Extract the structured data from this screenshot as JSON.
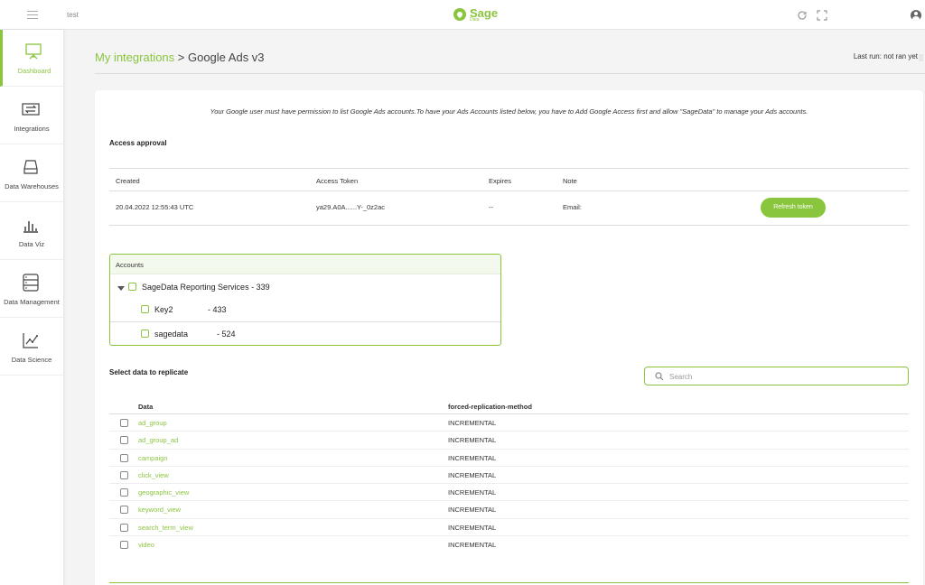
{
  "topbar": {
    "title": "test",
    "logo_big": "Sage",
    "logo_small": "Data"
  },
  "sidebar": {
    "items": [
      {
        "label": "Dashboard",
        "icon": "presentation-board-icon",
        "active": true
      },
      {
        "label": "Integrations",
        "icon": "arrows-exchange-icon",
        "active": false
      },
      {
        "label": "Data Warehouses",
        "icon": "hard-drive-icon",
        "active": false
      },
      {
        "label": "Data Viz",
        "icon": "bar-chart-icon",
        "active": false
      },
      {
        "label": "Data Management",
        "icon": "server-rack-icon",
        "active": false
      },
      {
        "label": "Data Science",
        "icon": "line-graph-icon",
        "active": false
      }
    ]
  },
  "header": {
    "breadcrumb_link": "My integrations",
    "breadcrumb_sep": " > ",
    "breadcrumb_current": "Google Ads v3",
    "last_run": "Last run: not ran yet"
  },
  "notice": "Your Google user must have permission to list Google Ads accounts.To have your Ads Accounts listed below, you have to Add Google Access first and allow \"SageData\" to manage your Ads accounts.",
  "access": {
    "title": "Access approval",
    "columns": [
      "Created",
      "Access Token",
      "Expires",
      "Note"
    ],
    "row": {
      "created": "20.04.2022 12:55:43 UTC",
      "token": "ya29.A0A......Y-_0z2ac",
      "expires": "--",
      "note": "Email:",
      "button": "Refresh token"
    }
  },
  "accounts": {
    "title": "Accounts",
    "parent": "SageData Reporting Services - 339",
    "children": [
      {
        "name": "Key2",
        "id": "- 433"
      },
      {
        "name": "sagedata",
        "id": "- 524"
      }
    ]
  },
  "replicate": {
    "title": "Select data to replicate",
    "search_placeholder": "Search",
    "columns": [
      "Data",
      "forced-replication-method"
    ],
    "rows": [
      {
        "name": "ad_group",
        "method": "INCREMENTAL"
      },
      {
        "name": "ad_group_ad",
        "method": "INCREMENTAL"
      },
      {
        "name": "campaign",
        "method": "INCREMENTAL"
      },
      {
        "name": "click_view",
        "method": "INCREMENTAL"
      },
      {
        "name": "geographic_view",
        "method": "INCREMENTAL"
      },
      {
        "name": "keyword_view",
        "method": "INCREMENTAL"
      },
      {
        "name": "search_term_view",
        "method": "INCREMENTAL"
      },
      {
        "name": "video",
        "method": "INCREMENTAL"
      }
    ]
  },
  "colors": {
    "accent": "#8ac53e",
    "background": "#f4f4f4"
  }
}
